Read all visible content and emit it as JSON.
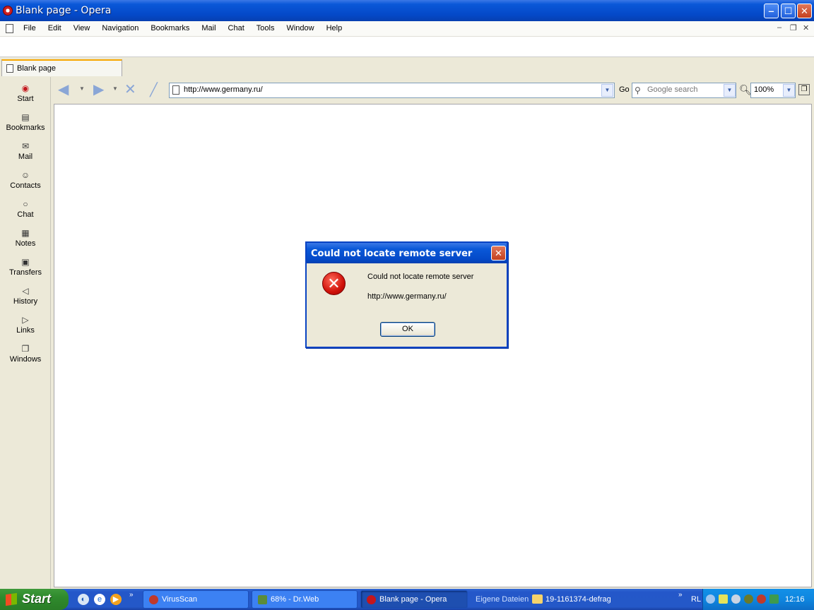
{
  "window": {
    "title": "Blank page - Opera",
    "minimize": "‒",
    "maximize": "☐",
    "close": "✕"
  },
  "menubar": {
    "items": [
      "File",
      "Edit",
      "View",
      "Navigation",
      "Bookmarks",
      "Mail",
      "Chat",
      "Tools",
      "Window",
      "Help"
    ],
    "mdi_min": "‒",
    "mdi_restore": "❐",
    "mdi_close": "✕"
  },
  "tab": {
    "label": "Blank page"
  },
  "sidepanel": {
    "items": [
      {
        "label": "Start",
        "icon": "opera-start-icon"
      },
      {
        "label": "Bookmarks",
        "icon": "bookmarks-icon"
      },
      {
        "label": "Mail",
        "icon": "mail-icon"
      },
      {
        "label": "Contacts",
        "icon": "contacts-icon"
      },
      {
        "label": "Chat",
        "icon": "chat-icon"
      },
      {
        "label": "Notes",
        "icon": "notes-icon"
      },
      {
        "label": "Transfers",
        "icon": "transfers-icon"
      },
      {
        "label": "History",
        "icon": "history-icon"
      },
      {
        "label": "Links",
        "icon": "links-icon"
      },
      {
        "label": "Windows",
        "icon": "windows-icon"
      }
    ]
  },
  "toolbar": {
    "address": "http://www.germany.ru/",
    "go": "Go",
    "search_placeholder": "Google search",
    "zoom": "100%"
  },
  "dialog": {
    "title": "Could not locate remote server",
    "message": "Could not locate remote server",
    "url": "http://www.germany.ru/",
    "ok": "OK"
  },
  "taskbar": {
    "start": "Start",
    "tasks": [
      {
        "label": "VirusScan",
        "active": false
      },
      {
        "label": "68% - Dr.Web",
        "active": false
      },
      {
        "label": "Blank page - Opera",
        "active": true
      }
    ],
    "folder1": "Eigene Dateien",
    "folder2": "19-1161374-defrag",
    "lang": "RL",
    "clock": "12:16"
  }
}
